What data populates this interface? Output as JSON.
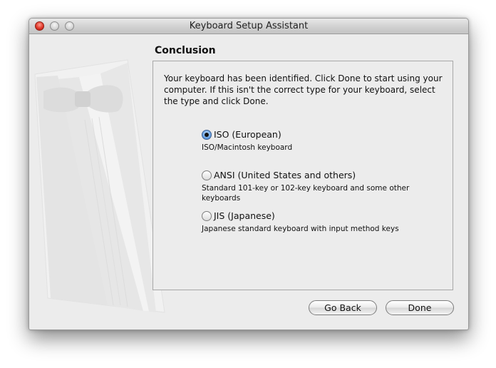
{
  "window": {
    "title": "Keyboard Setup Assistant"
  },
  "main": {
    "heading": "Conclusion",
    "intro": "Your keyboard has been identified. Click Done to start using your computer. If this isn't the correct type for your keyboard, select the type and click Done.",
    "options": [
      {
        "label": "ISO (European)",
        "description": "ISO/Macintosh keyboard",
        "selected": true
      },
      {
        "label": "ANSI (United States and others)",
        "description": "Standard 101-key or 102-key keyboard and some other keyboards",
        "selected": false
      },
      {
        "label": "JIS (Japanese)",
        "description": "Japanese standard keyboard with input method keys",
        "selected": false
      }
    ]
  },
  "buttons": {
    "back_label": "Go Back",
    "done_label": "Done"
  },
  "colors": {
    "close": "#e0382a",
    "selected_radio": "#3b78c8"
  }
}
